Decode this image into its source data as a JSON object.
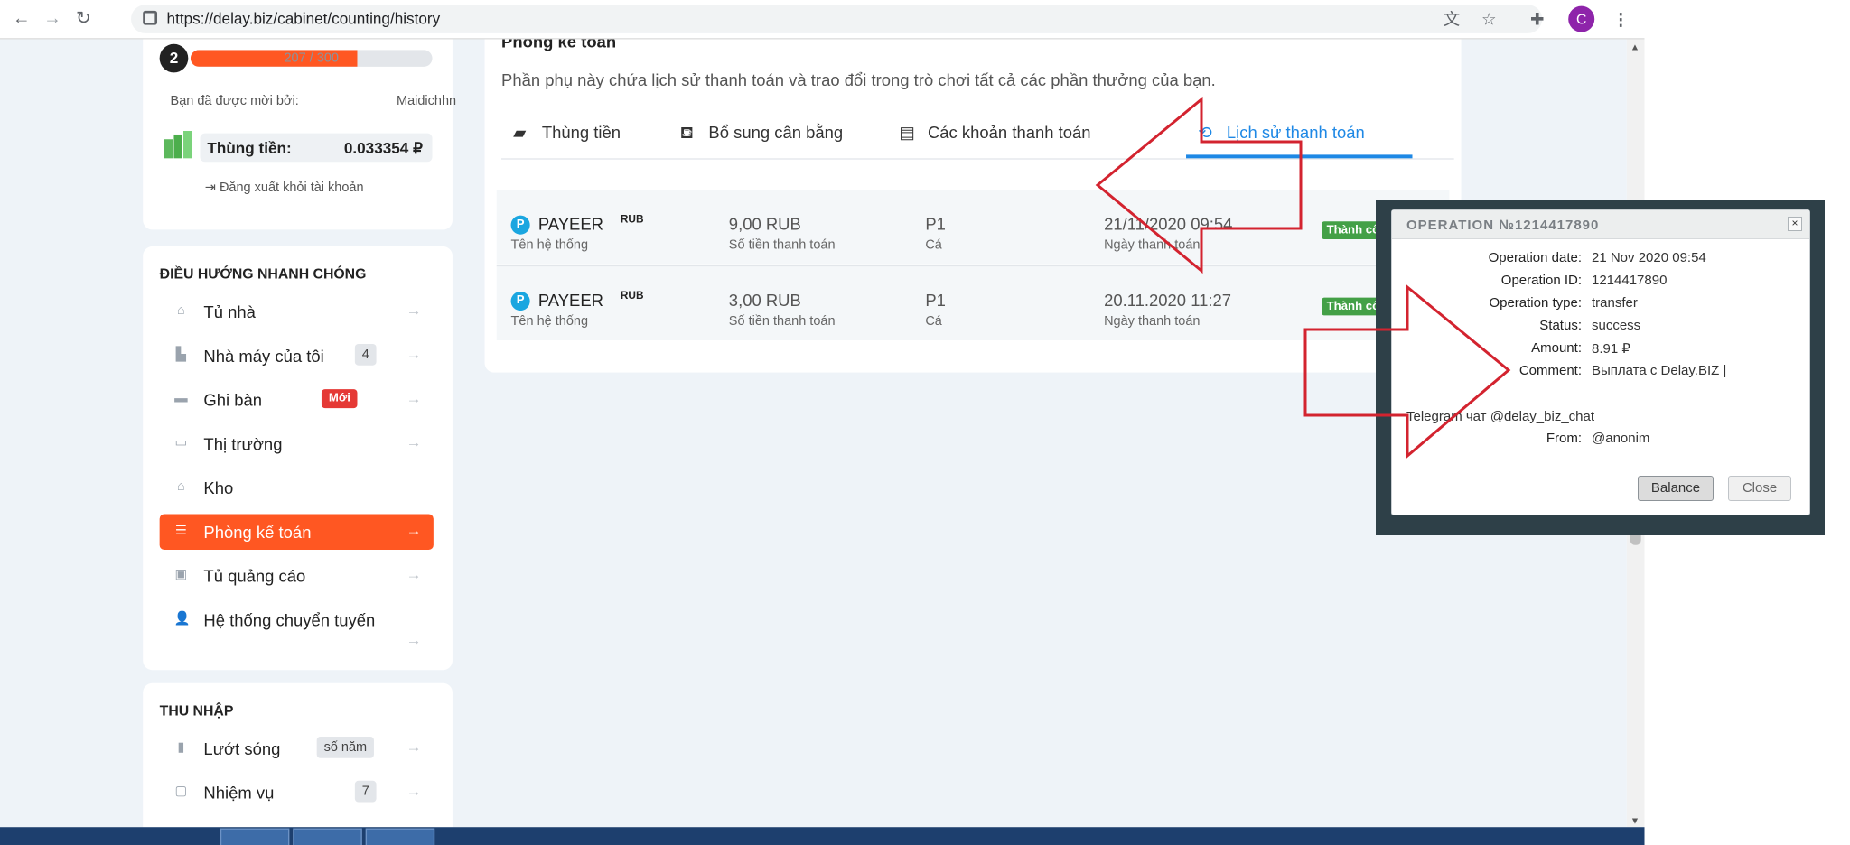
{
  "browser": {
    "url": "https://delay.biz/cabinet/counting/history",
    "avatar_letter": "C"
  },
  "sidebar": {
    "level": "2",
    "xp_text": "207 / 300",
    "xp_progress": 0.69,
    "invited_label": "Bạn đã được mời bởi:",
    "invited_user": "Maidichhn",
    "money_label": "Thùng tiền:",
    "money_value": "0.033354 ₽",
    "logout_label": "Đăng xuất khỏi tài khoản",
    "nav_title": "ĐIỀU HƯỚNG NHANH CHÓNG",
    "nav_items": [
      {
        "label": "Tủ nhà",
        "badge": ""
      },
      {
        "label": "Nhà máy của tôi",
        "badge": "4"
      },
      {
        "label": "Ghi bàn",
        "badge": "Mới"
      },
      {
        "label": "Thị trường",
        "badge": ""
      },
      {
        "label": "Kho",
        "badge": ""
      },
      {
        "label": "Phòng kế toán",
        "badge": ""
      },
      {
        "label": "Tủ quảng cáo",
        "badge": ""
      },
      {
        "label": "Hệ thống chuyển tuyến",
        "badge": ""
      }
    ],
    "active_index": 5,
    "income_title": "THU NHẬP",
    "income_items": [
      {
        "label": "Lướt sóng",
        "badge": "số năm"
      },
      {
        "label": "Nhiệm vụ",
        "badge": "7"
      }
    ]
  },
  "main": {
    "title": "Phòng kế toán",
    "description": "Phần phụ này chứa lịch sử thanh toán và trao đổi trong trò chơi tất cả các phần thưởng của bạn.",
    "tabs": [
      {
        "label": "Thùng tiền",
        "icon": "wallet-icon"
      },
      {
        "label": "Bổ sung cân bằng",
        "icon": "basket-icon"
      },
      {
        "label": "Các khoản thanh toán",
        "icon": "banknote-icon"
      },
      {
        "label": "Lịch sử thanh toán",
        "icon": "history-icon"
      }
    ],
    "active_tab": 3,
    "transactions": [
      {
        "system": "PAYEER",
        "currency": "RUB",
        "system_sub": "Tên hệ thống",
        "amount": "9,00 RUB",
        "amount_sub": "Số tiền thanh toán",
        "account": "P1",
        "account_sub": "Cá",
        "date": "21/11/2020 09:54",
        "date_sub": "Ngày thanh toán",
        "status": "Thành công"
      },
      {
        "system": "PAYEER",
        "currency": "RUB",
        "system_sub": "Tên hệ thống",
        "amount": "3,00 RUB",
        "amount_sub": "Số tiền thanh toán",
        "account": "P1",
        "account_sub": "Cá",
        "date": "20.11.2020 11:27",
        "date_sub": "Ngày thanh toán",
        "status": "Thành công"
      }
    ]
  },
  "operation": {
    "title": "OPERATION №1214417890",
    "fields": [
      {
        "label": "Operation date:",
        "value": "21 Nov 2020 09:54"
      },
      {
        "label": "Operation ID:",
        "value": "1214417890"
      },
      {
        "label": "Operation type:",
        "value": "transfer"
      },
      {
        "label": "Status:",
        "value": "success"
      },
      {
        "label": "Amount:",
        "value": "8.91 ₽"
      },
      {
        "label": "Comment:",
        "value": "Выплата с Delay.BIZ |"
      }
    ],
    "comment_cont": "Telegram чат @delay_biz_chat",
    "from_label": "From:",
    "from_value": "@anonim",
    "balance_btn": "Balance",
    "close_btn": "Close"
  },
  "colors": {
    "accent": "#ff5722",
    "tab_active": "#1e88e5",
    "success": "#43a047",
    "arrow": "#d3232f"
  }
}
